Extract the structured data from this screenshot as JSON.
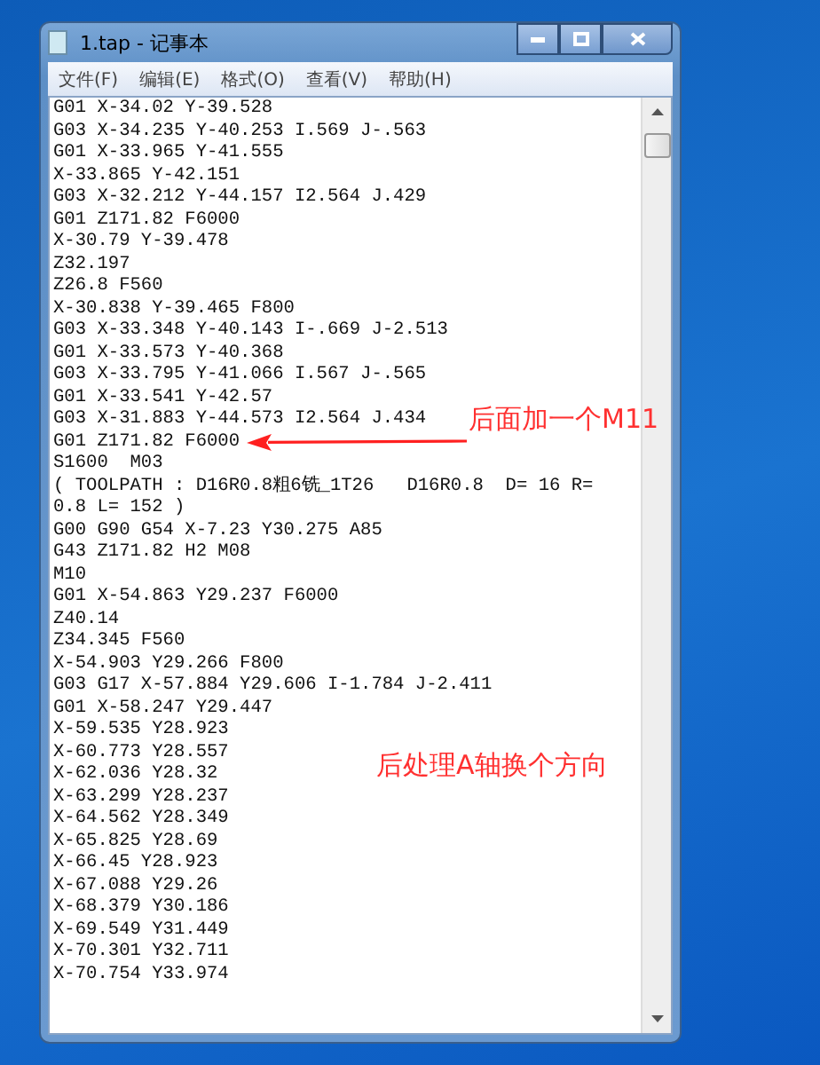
{
  "window": {
    "title": "1.tap - 记事本"
  },
  "menu": [
    {
      "label": "文件(F)"
    },
    {
      "label": "编辑(E)"
    },
    {
      "label": "格式(O)"
    },
    {
      "label": "查看(V)"
    },
    {
      "label": "帮助(H)"
    }
  ],
  "lines": [
    "G01 X-34.02 Y-39.528",
    "G03 X-34.235 Y-40.253 I.569 J-.563",
    "G01 X-33.965 Y-41.555",
    "X-33.865 Y-42.151",
    "G03 X-32.212 Y-44.157 I2.564 J.429",
    "G01 Z171.82 F6000",
    "X-30.79 Y-39.478",
    "Z32.197",
    "Z26.8 F560",
    "X-30.838 Y-39.465 F800",
    "G03 X-33.348 Y-40.143 I-.669 J-2.513",
    "G01 X-33.573 Y-40.368",
    "G03 X-33.795 Y-41.066 I.567 J-.565",
    "G01 X-33.541 Y-42.57",
    "G03 X-31.883 Y-44.573 I2.564 J.434",
    "G01 Z171.82 F6000",
    "S1600  M03",
    "( TOOLPATH : D16R0.8粗6铣_1T26   D16R0.8  D= 16 R=",
    "0.8 L= 152 )",
    "G00 G90 G54 X-7.23 Y30.275 A85",
    "G43 Z171.82 H2 M08",
    "M10",
    "G01 X-54.863 Y29.237 F6000",
    "Z40.14",
    "Z34.345 F560",
    "X-54.903 Y29.266 F800",
    "G03 G17 X-57.884 Y29.606 I-1.784 J-2.411",
    "G01 X-58.247 Y29.447",
    "X-59.535 Y28.923",
    "X-60.773 Y28.557",
    "X-62.036 Y28.32",
    "X-63.299 Y28.237",
    "X-64.562 Y28.349",
    "X-65.825 Y28.69",
    "X-66.45 Y28.923",
    "X-67.088 Y29.26",
    "X-68.379 Y30.186",
    "X-69.549 Y31.449",
    "X-70.301 Y32.711",
    "X-70.754 Y33.974"
  ],
  "annotations": [
    {
      "text": "后面加一个M11",
      "kind": "arrow"
    },
    {
      "text": "后处理A轴换个方向",
      "kind": "note"
    }
  ]
}
